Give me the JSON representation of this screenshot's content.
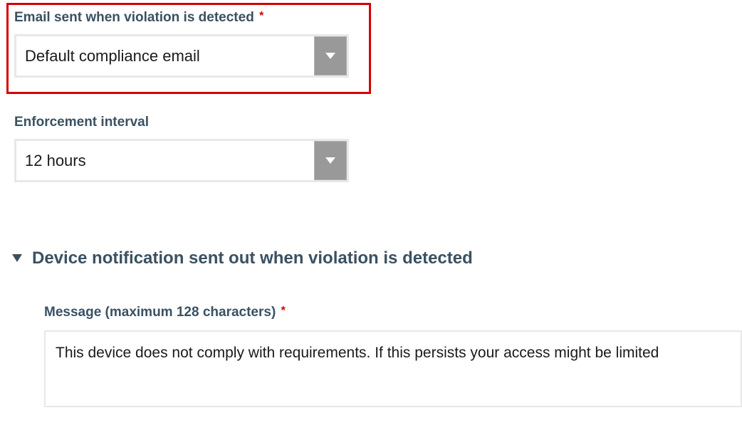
{
  "email_field": {
    "label": "Email sent when violation is detected",
    "required_marker": "*",
    "value": "Default compliance email"
  },
  "interval_field": {
    "label": "Enforcement interval",
    "value": "12 hours"
  },
  "section": {
    "title": "Device notification sent out when violation is detected"
  },
  "message_field": {
    "label": "Message (maximum 128 characters)",
    "required_marker": "*",
    "value": "This device does not comply with requirements. If this persists your access might be limited"
  }
}
